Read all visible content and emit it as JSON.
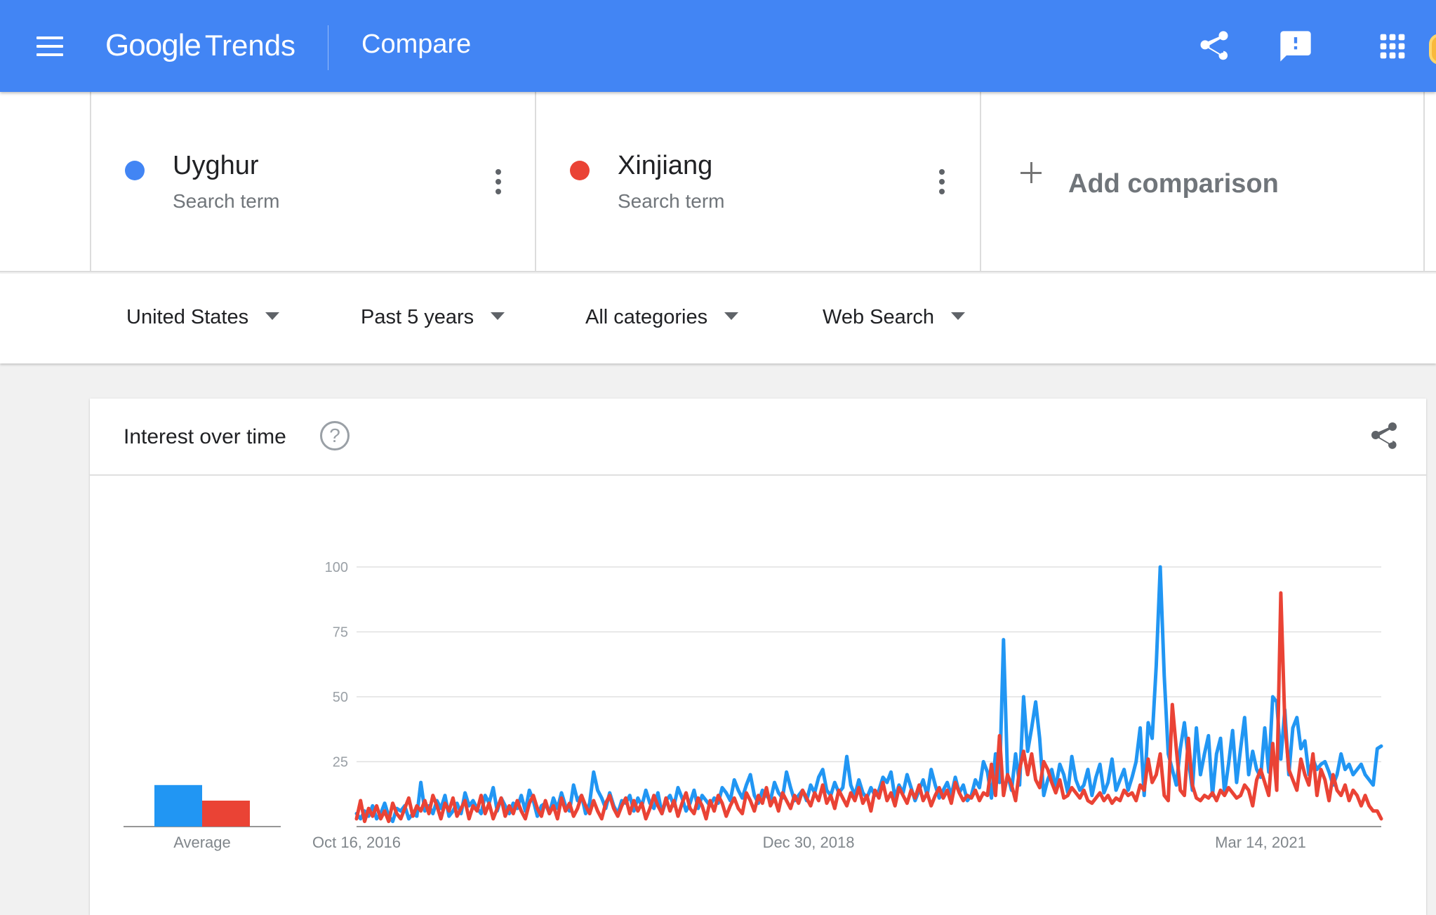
{
  "header": {
    "logo_google": "Google",
    "logo_trends": "Trends",
    "page_title": "Compare",
    "icons": [
      "menu-icon",
      "share-icon",
      "feedback-icon",
      "apps-grid-icon"
    ],
    "accent_color": "#4285f4"
  },
  "terms": [
    {
      "name": "Uyghur",
      "type": "Search term",
      "color": "#4285f4"
    },
    {
      "name": "Xinjiang",
      "type": "Search term",
      "color": "#ea4335"
    }
  ],
  "add_comparison": "Add comparison",
  "filters": {
    "region": "United States",
    "time": "Past 5 years",
    "category": "All categories",
    "property": "Web Search"
  },
  "card": {
    "title": "Interest over time",
    "help": "?"
  },
  "chart_data": {
    "type": "line",
    "yticks": [
      100,
      75,
      50,
      25
    ],
    "ylim": [
      0,
      100
    ],
    "xtick_labels": [
      "Oct 16, 2016",
      "Dec 30, 2018",
      "Mar 14, 2021"
    ],
    "x_range": [
      "Oct 16, 2016",
      "Oct 2021"
    ],
    "average": {
      "label": "Average",
      "values": [
        16,
        10
      ]
    },
    "grid": true,
    "series": [
      {
        "name": "Uyghur",
        "color": "#2196f3",
        "values": [
          5,
          3,
          6,
          4,
          8,
          3,
          5,
          9,
          4,
          2,
          7,
          6,
          8,
          3,
          5,
          4,
          17,
          6,
          8,
          5,
          10,
          7,
          12,
          4,
          6,
          9,
          5,
          13,
          8,
          10,
          7,
          5,
          12,
          9,
          15,
          6,
          11,
          8,
          5,
          9,
          7,
          12,
          6,
          14,
          10,
          4,
          8,
          9,
          5,
          11,
          7,
          13,
          8,
          6,
          16,
          10,
          12,
          5,
          9,
          21,
          14,
          11,
          7,
          13,
          8,
          5,
          10,
          9,
          12,
          6,
          11,
          8,
          14,
          9,
          7,
          13,
          5,
          10,
          12,
          8,
          15,
          11,
          6,
          9,
          14,
          7,
          12,
          10,
          8,
          11,
          9,
          15,
          13,
          10,
          18,
          14,
          11,
          16,
          20,
          12,
          9,
          14,
          12,
          10,
          17,
          13,
          11,
          21,
          15,
          10,
          12,
          14,
          10,
          16,
          13,
          19,
          22,
          14,
          12,
          17,
          13,
          15,
          27,
          16,
          12,
          18,
          13,
          11,
          15,
          12,
          14,
          19,
          17,
          21,
          11,
          16,
          13,
          20,
          15,
          10,
          14,
          18,
          12,
          22,
          16,
          11,
          14,
          17,
          12,
          19,
          13,
          16,
          10,
          12,
          18,
          15,
          25,
          21,
          11,
          28,
          17,
          72,
          20,
          14,
          28,
          16,
          50,
          29,
          38,
          48,
          34,
          12,
          18,
          22,
          15,
          24,
          20,
          13,
          27,
          18,
          14,
          16,
          22,
          12,
          19,
          24,
          13,
          17,
          26,
          14,
          18,
          22,
          14,
          19,
          25,
          38,
          12,
          40,
          34,
          62,
          100,
          58,
          28,
          22,
          16,
          30,
          40,
          26,
          14,
          38,
          20,
          28,
          35,
          12,
          28,
          34,
          13,
          24,
          37,
          17,
          30,
          42,
          20,
          29,
          22,
          19,
          38,
          21,
          50,
          48,
          26,
          45,
          20,
          38,
          42,
          30,
          33,
          20,
          26,
          22,
          24,
          25,
          21,
          16,
          20,
          28,
          22,
          24,
          20,
          22,
          24,
          20,
          18,
          16,
          30,
          31
        ]
      },
      {
        "name": "Xinjiang",
        "color": "#ea4335",
        "values": [
          3,
          10,
          2,
          7,
          4,
          8,
          3,
          6,
          2,
          9,
          5,
          3,
          7,
          11,
          4,
          8,
          6,
          10,
          5,
          12,
          8,
          3,
          9,
          6,
          11,
          4,
          7,
          10,
          3,
          8,
          6,
          12,
          5,
          9,
          3,
          7,
          11,
          4,
          8,
          5,
          10,
          6,
          3,
          9,
          12,
          7,
          4,
          10,
          5,
          8,
          3,
          11,
          6,
          9,
          4,
          7,
          12,
          8,
          5,
          10,
          6,
          3,
          9,
          12,
          7,
          4,
          8,
          11,
          5,
          10,
          6,
          9,
          3,
          7,
          12,
          8,
          5,
          11,
          6,
          10,
          4,
          9,
          13,
          7,
          5,
          11,
          8,
          3,
          10,
          6,
          12,
          9,
          4,
          8,
          11,
          7,
          5,
          13,
          10,
          6,
          12,
          9,
          15,
          8,
          11,
          6,
          13,
          10,
          7,
          12,
          9,
          14,
          11,
          8,
          13,
          10,
          16,
          9,
          12,
          7,
          14,
          11,
          8,
          13,
          10,
          15,
          9,
          12,
          6,
          14,
          11,
          17,
          10,
          13,
          8,
          15,
          12,
          9,
          14,
          11,
          16,
          10,
          13,
          8,
          12,
          15,
          11,
          14,
          9,
          17,
          13,
          10,
          12,
          11,
          14,
          10,
          13,
          12,
          24,
          12,
          35,
          12,
          20,
          16,
          10,
          22,
          29,
          20,
          28,
          18,
          15,
          25,
          22,
          17,
          13,
          18,
          11,
          12,
          15,
          13,
          11,
          14,
          10,
          9,
          11,
          13,
          10,
          12,
          9,
          11,
          10,
          14,
          12,
          13,
          10,
          16,
          14,
          26,
          17,
          20,
          28,
          12,
          10,
          47,
          30,
          14,
          12,
          34,
          16,
          11,
          10,
          12,
          11,
          13,
          10,
          14,
          12,
          15,
          13,
          11,
          12,
          16,
          14,
          8,
          18,
          22,
          17,
          12,
          32,
          14,
          90,
          40,
          22,
          18,
          14,
          26,
          20,
          16,
          28,
          12,
          22,
          18,
          10,
          20,
          14,
          12,
          16,
          10,
          14,
          12,
          8,
          12,
          8,
          6,
          6,
          3
        ]
      }
    ]
  }
}
